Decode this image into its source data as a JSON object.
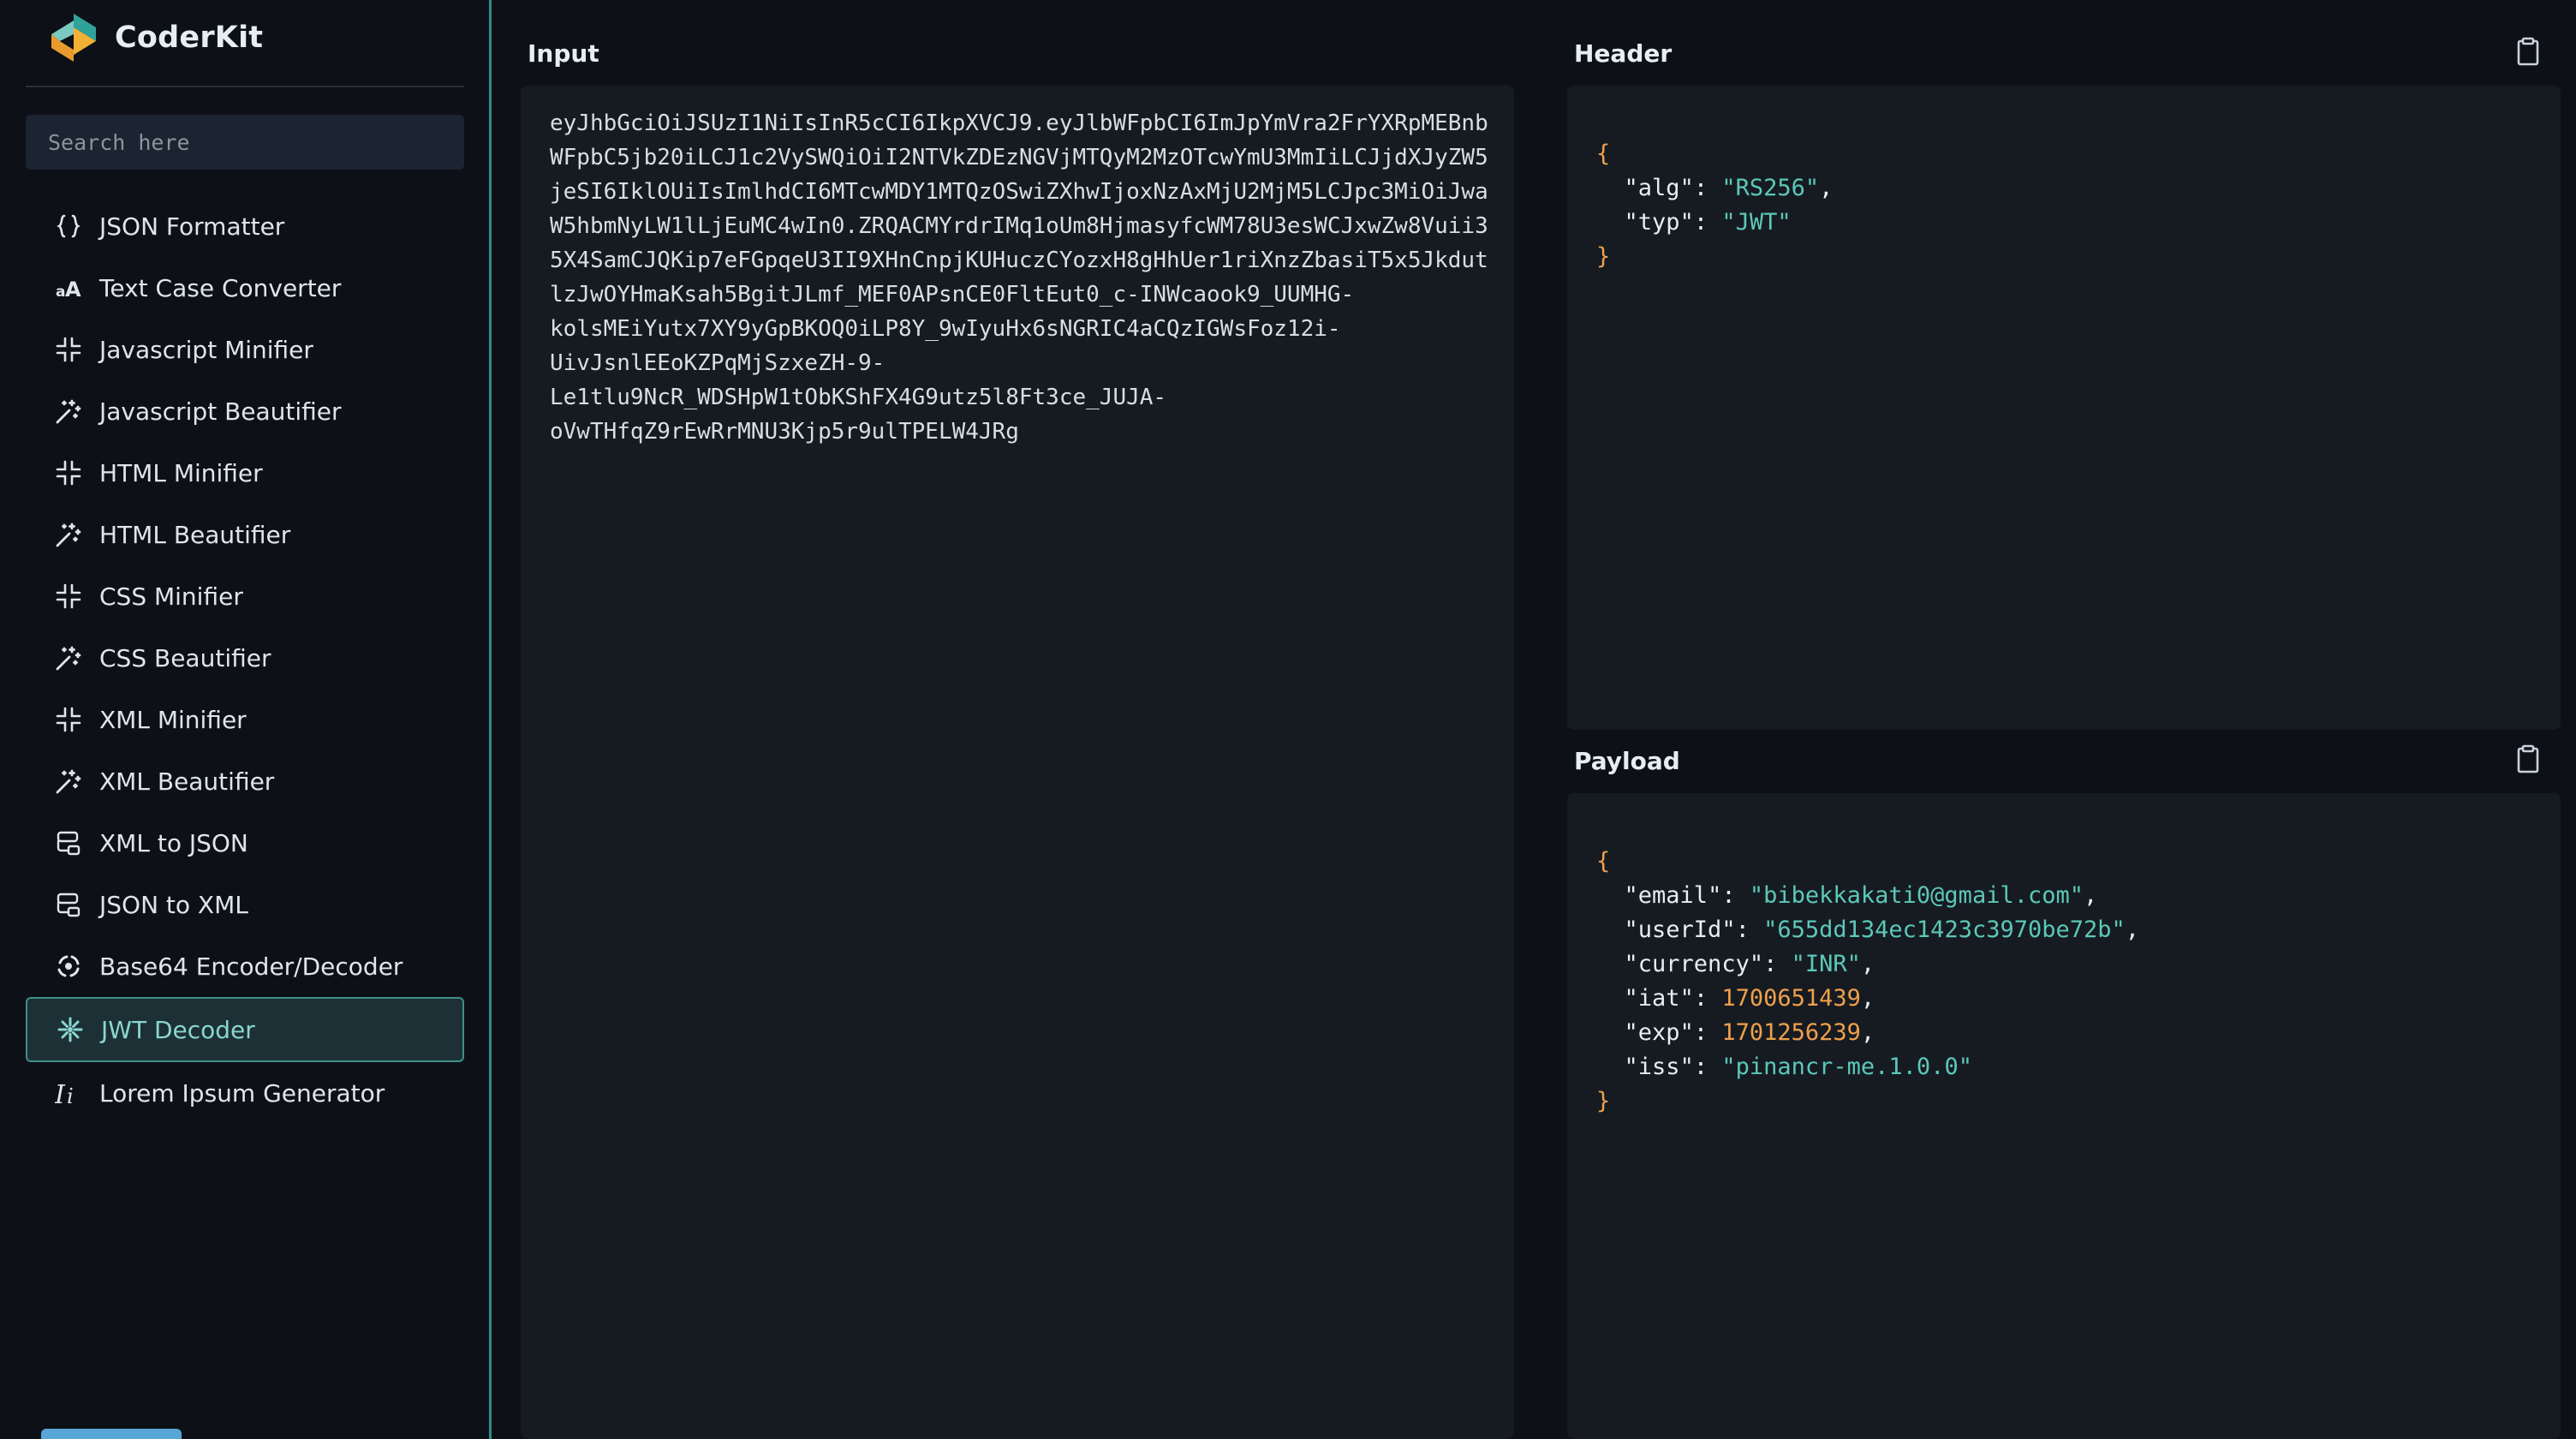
{
  "brand": {
    "name": "CoderKit"
  },
  "search": {
    "placeholder": "Search here"
  },
  "sidebar": {
    "items": [
      {
        "label": "JSON Formatter",
        "icon": "braces-icon"
      },
      {
        "label": "Text Case Converter",
        "icon": "text-case-icon"
      },
      {
        "label": "Javascript Minifier",
        "icon": "minify-icon"
      },
      {
        "label": "Javascript Beautifier",
        "icon": "magic-wand-icon"
      },
      {
        "label": "HTML Minifier",
        "icon": "minify-icon"
      },
      {
        "label": "HTML Beautifier",
        "icon": "magic-wand-icon"
      },
      {
        "label": "CSS Minifier",
        "icon": "minify-icon"
      },
      {
        "label": "CSS Beautifier",
        "icon": "magic-wand-icon"
      },
      {
        "label": "XML Minifier",
        "icon": "minify-icon"
      },
      {
        "label": "XML Beautifier",
        "icon": "magic-wand-icon"
      },
      {
        "label": "XML to JSON",
        "icon": "convert-icon"
      },
      {
        "label": "JSON to XML",
        "icon": "convert-icon"
      },
      {
        "label": "Base64 Encoder/Decoder",
        "icon": "base64-icon"
      },
      {
        "label": "JWT Decoder",
        "icon": "jwt-icon",
        "active": true
      },
      {
        "label": "Lorem Ipsum Generator",
        "icon": "italic-icon"
      }
    ]
  },
  "input": {
    "title": "Input",
    "value": "eyJhbGciOiJSUzI1NiIsInR5cCI6IkpXVCJ9.eyJlbWFpbCI6ImJpYmVra2FrYXRpMEBnbWFpbC5jb20iLCJ1c2VySWQiOiI2NTVkZDEzNGVjMTQyM2MzOTcwYmU3MmIiLCJjdXJyZW5jeSI6IklOUiIsImlhdCI6MTcwMDY1MTQzOSwiZXhwIjoxNzAxMjU2MjM5LCJpc3MiOiJwaW5hbmNyLW1lLjEuMC4wIn0.ZRQACMYrdrIMq1oUm8HjmasyfcWM78U3esWCJxwZw8Vuii35X4SamCJQKip7eFGpqeU3II9XHnCnpjKUHuczCYozxH8gHhUer1riXnzZbasiT5x5JkdutlzJwOYHmaKsah5BgitJLmf_MEF0APsnCE0FltEut0_c-INWcaook9_UUMHG-\nkolsMEiYutx7XY9yGpBKOQ0iLP8Y_9wIyuHx6sNGRIC4aCQzIGWsFoz12i-\nUivJsnlEEoKZPqMjSzxeZH-9-\nLe1tlu9NcR_WDSHpW1tObKShFX4G9utz5l8Ft3ce_JUJA-\noVwTHfqZ9rEwRrMNU3Kjp5r9ulTPELW4JRg"
  },
  "header": {
    "title": "Header",
    "fields": [
      {
        "key": "alg",
        "value": "RS256",
        "kind": "string"
      },
      {
        "key": "typ",
        "value": "JWT",
        "kind": "string"
      }
    ]
  },
  "payload": {
    "title": "Payload",
    "fields": [
      {
        "key": "email",
        "value": "bibekkakati0@gmail.com",
        "kind": "string"
      },
      {
        "key": "userId",
        "value": "655dd134ec1423c3970be72b",
        "kind": "string"
      },
      {
        "key": "currency",
        "value": "INR",
        "kind": "string"
      },
      {
        "key": "iat",
        "value": "1700651439",
        "kind": "number"
      },
      {
        "key": "exp",
        "value": "1701256239",
        "kind": "number"
      },
      {
        "key": "iss",
        "value": "pinancr-me.1.0.0",
        "kind": "string"
      }
    ]
  },
  "colors": {
    "accent": "#3f8f8a",
    "string": "#5cc8b9",
    "number": "#f0a04b",
    "brace": "#f0a04b"
  }
}
